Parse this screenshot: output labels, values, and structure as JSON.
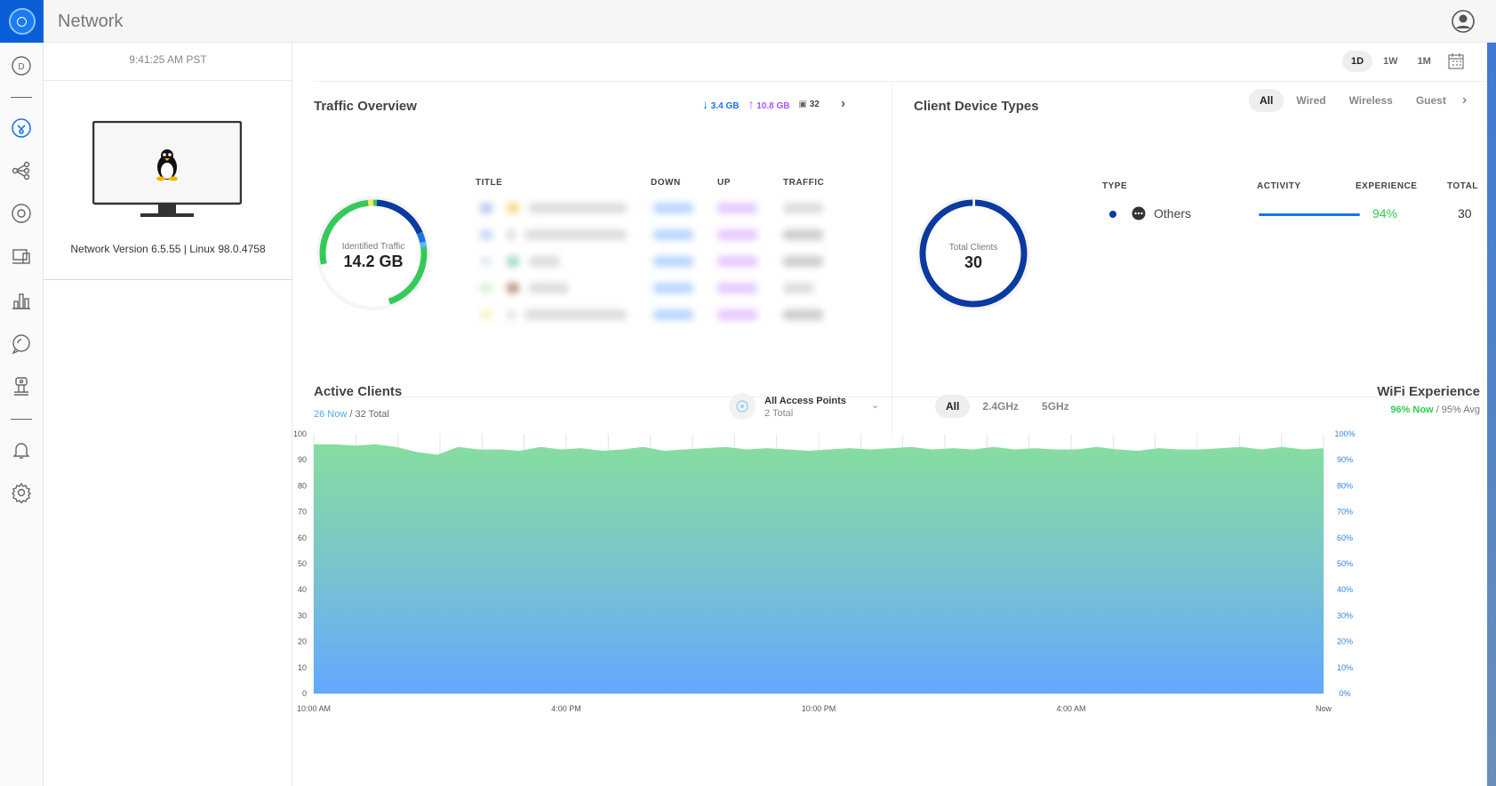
{
  "app": {
    "title": "Network"
  },
  "device": {
    "clock": "9:41:25 AM PST",
    "version": "Network Version 6.5.55 | Linux 98.0.4758"
  },
  "time_range": {
    "options": [
      "1D",
      "1W",
      "1M"
    ],
    "active": "1D"
  },
  "traffic": {
    "title": "Traffic Overview",
    "down": "3.4 GB",
    "up": "10.8 GB",
    "clients": "32",
    "donut_label": "Identified Traffic",
    "donut_value": "14.2 GB",
    "columns": [
      "TITLE",
      "DOWN",
      "UP",
      "TRAFFIC"
    ]
  },
  "client_types": {
    "title": "Client Device Types",
    "tabs": [
      "All",
      "Wired",
      "Wireless",
      "Guest"
    ],
    "active_tab": "All",
    "donut_label": "Total Clients",
    "donut_value": "30",
    "columns": [
      "TYPE",
      "ACTIVITY",
      "EXPERIENCE",
      "TOTAL"
    ],
    "rows": [
      {
        "type": "Others",
        "experience": "94%",
        "total": "30"
      }
    ]
  },
  "active_clients": {
    "title": "Active Clients",
    "now": "26 Now",
    "total": " / 32 Total",
    "ap_title": "All Access Points",
    "ap_sub": "2 Total",
    "bands": [
      "All",
      "2.4GHz",
      "5GHz"
    ],
    "active_band": "All"
  },
  "wifi_experience": {
    "title": "WiFi Experience",
    "now": "96% Now",
    "avg": " / 95% Avg"
  },
  "colors": {
    "brand": "#0a5fd8",
    "green": "#35c95a",
    "blue": "#1a73e8",
    "navy": "#0b3aa0",
    "purple": "#a855f7"
  },
  "chart_data": {
    "type": "area",
    "x": [
      "10:00 AM",
      "4:00 PM",
      "10:00 PM",
      "4:00 AM",
      "Now"
    ],
    "y_left": {
      "ylim": [
        0,
        100
      ],
      "ticks": [
        0,
        10,
        20,
        30,
        40,
        50,
        60,
        70,
        80,
        90,
        100
      ]
    },
    "y_right": {
      "ylim": [
        0,
        100
      ],
      "ticks": [
        "0%",
        "10%",
        "20%",
        "30%",
        "40%",
        "50%",
        "60%",
        "70%",
        "80%",
        "90%",
        "100%"
      ]
    },
    "series": [
      {
        "values": [
          96,
          96,
          95.5,
          96,
          95,
          93,
          92,
          95,
          94,
          94,
          93.5,
          95,
          94,
          94.5,
          93.5,
          94,
          95,
          93.5,
          94,
          94.5,
          95,
          94,
          94.5,
          94,
          93.5,
          94,
          94.5,
          94,
          94.5,
          95,
          94,
          94.5,
          94,
          95,
          94,
          94.5,
          94,
          94,
          95,
          94,
          93.5,
          94.5,
          94,
          94,
          94.5,
          95,
          94,
          95,
          94,
          94.5
        ]
      }
    ]
  }
}
